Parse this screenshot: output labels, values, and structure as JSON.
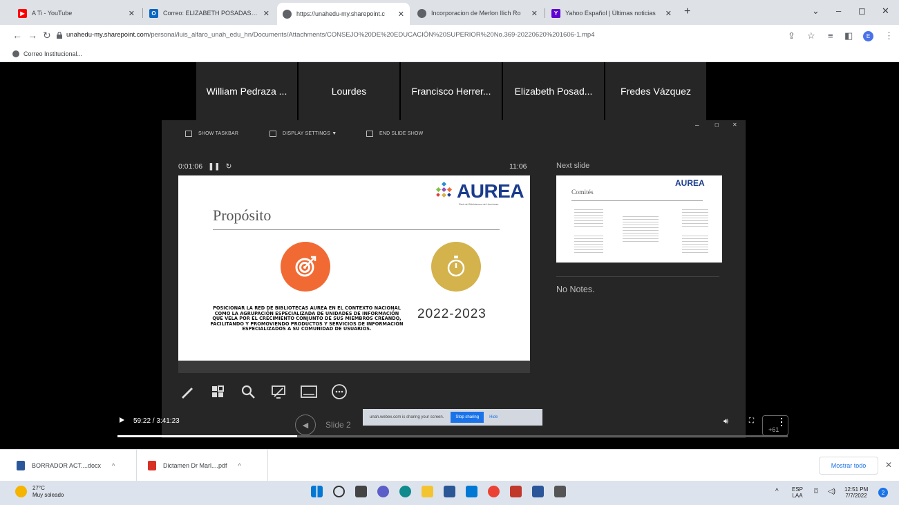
{
  "tabs": [
    {
      "title": "A Ti - YouTube",
      "favicon": "youtube-icon",
      "color": "#ff0000",
      "active": false
    },
    {
      "title": "Correo: ELIZABETH POSADAS CR",
      "favicon": "outlook-icon",
      "color": "#0a66c2",
      "active": false
    },
    {
      "title": "https://unahedu-my.sharepoint.c",
      "favicon": "globe-icon",
      "color": "#5f6368",
      "active": true
    },
    {
      "title": "Incorporacion de Merlon Ilich Ro",
      "favicon": "globe-icon",
      "color": "#5f6368",
      "active": false
    },
    {
      "title": "Yahoo Español | Últimas noticias",
      "favicon": "yahoo-icon",
      "color": "#6001d2",
      "active": false
    }
  ],
  "address": {
    "host": "unahedu-my.sharepoint.com",
    "path": "/personal/luis_alfaro_unah_edu_hn/Documents/Attachments/CONSEJO%20DE%20EDUCACIÓN%20SUPERIOR%20No.369-20220620%201606-1.mp4"
  },
  "profile_initial": "E",
  "bookmarks": [
    {
      "label": "Correo Institucional..."
    }
  ],
  "participants": [
    "William Pedraza ...",
    "Lourdes",
    "Francisco Herrer...",
    "Elizabeth Posad...",
    "Fredes Vázquez"
  ],
  "presenter": {
    "toolbar": {
      "show_taskbar": "SHOW TASKBAR",
      "display_settings": "DISPLAY SETTINGS ▼",
      "end_slide_show": "END SLIDE SHOW"
    },
    "window_min": "–",
    "window_restore": "◻",
    "window_close": "✕",
    "elapsed": "0:01:06",
    "clock": "11:06",
    "next_slide_label": "Next slide",
    "notes": "No Notes.",
    "pager_label": "Slide 2"
  },
  "slide": {
    "title": "Propósito",
    "logo": "AUREA",
    "logo_sub": "Red de Bibliotecas de Honduras",
    "body": "POSICIONAR LA RED DE BIBLIOTECAS AUREA EN EL CONTEXTO NACIONAL COMO LA AGRUPACIÓN ESPECIALIZADA DE UNIDADES DE INFORMACIÓN QUE VELA POR EL CRECIMIENTO CONJUNTO DE SUS MIEMBROS CREANDO, FACILITANDO Y PROMOVIENDO PRODUCTOS Y SERVICIOS DE INFORMACIÓN ESPECIALIZADOS A SU COMUNIDAD DE USUARIOS.",
    "years": "2022-2023",
    "accent_orange": "#f26a33",
    "accent_gold": "#d4b24c"
  },
  "next_slide": {
    "title": "Comités",
    "logo": "AUREA"
  },
  "share_banner": {
    "text": "unah.webex.com is sharing your screen.",
    "stop": "Stop sharing",
    "hide": "Hide"
  },
  "video": {
    "time": "59:22 / 3:41:23",
    "progress_fraction": 0.268,
    "extra_count": "+61"
  },
  "downloads": [
    {
      "name": "BORRADOR ACT....docx",
      "icon": "word-doc-icon",
      "color": "#2b579a"
    },
    {
      "name": "Dictamen Dr Marl....pdf",
      "icon": "pdf-icon",
      "color": "#d93025"
    }
  ],
  "show_all": "Mostrar todo",
  "weather": {
    "temp": "27°C",
    "desc": "Muy soleado"
  },
  "tray": {
    "lang_top": "ESP",
    "lang_bottom": "LAA",
    "time": "12:51 PM",
    "date": "7/7/2022",
    "notifications": "2"
  }
}
